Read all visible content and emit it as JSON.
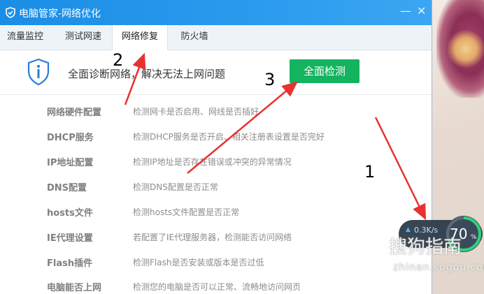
{
  "window": {
    "title": "电脑管家-网络优化",
    "minimize": "—",
    "close": "✕"
  },
  "tabs": [
    {
      "label": "流量监控"
    },
    {
      "label": "测试网速"
    },
    {
      "label": "网络修复"
    },
    {
      "label": "防火墙"
    }
  ],
  "active_tab": "网络修复",
  "header": {
    "description": "全面诊断网络，解决无法上网问题",
    "scan_button": "全面检测"
  },
  "items": [
    {
      "name": "网络硬件配置",
      "desc": "检测网卡是否启用、网线是否插好"
    },
    {
      "name": "DHCP服务",
      "desc": "检测DHCP服务是否开启、相关注册表设置是否完好"
    },
    {
      "name": "IP地址配置",
      "desc": "检测IP地址是否存在错误或冲突的异常情况"
    },
    {
      "name": "DNS配置",
      "desc": "检测DNS配置是否正常"
    },
    {
      "name": "hosts文件",
      "desc": "检测hosts文件配置是否正常"
    },
    {
      "name": "IE代理设置",
      "desc": "若配置了IE代理服务器，检测能否访问网络"
    },
    {
      "name": "Flash插件",
      "desc": "检测Flash是否安装或版本是否过低"
    },
    {
      "name": "电脑能否上网",
      "desc": "检测您的电脑是否可以正常、流畅地访问网页"
    }
  ],
  "annotations": {
    "label_1": "1",
    "label_2": "2",
    "label_3": "3",
    "arrow_color": "#e8322f"
  },
  "speed_widget": {
    "speed": "0.3K/s",
    "percent": "70",
    "percent_sign": "%"
  },
  "watermark": {
    "text": "搜狗指南",
    "sub": "zhinan.sogou.com"
  },
  "colors": {
    "titlebar": "#1a8de5",
    "scan_button": "#14b35f"
  }
}
